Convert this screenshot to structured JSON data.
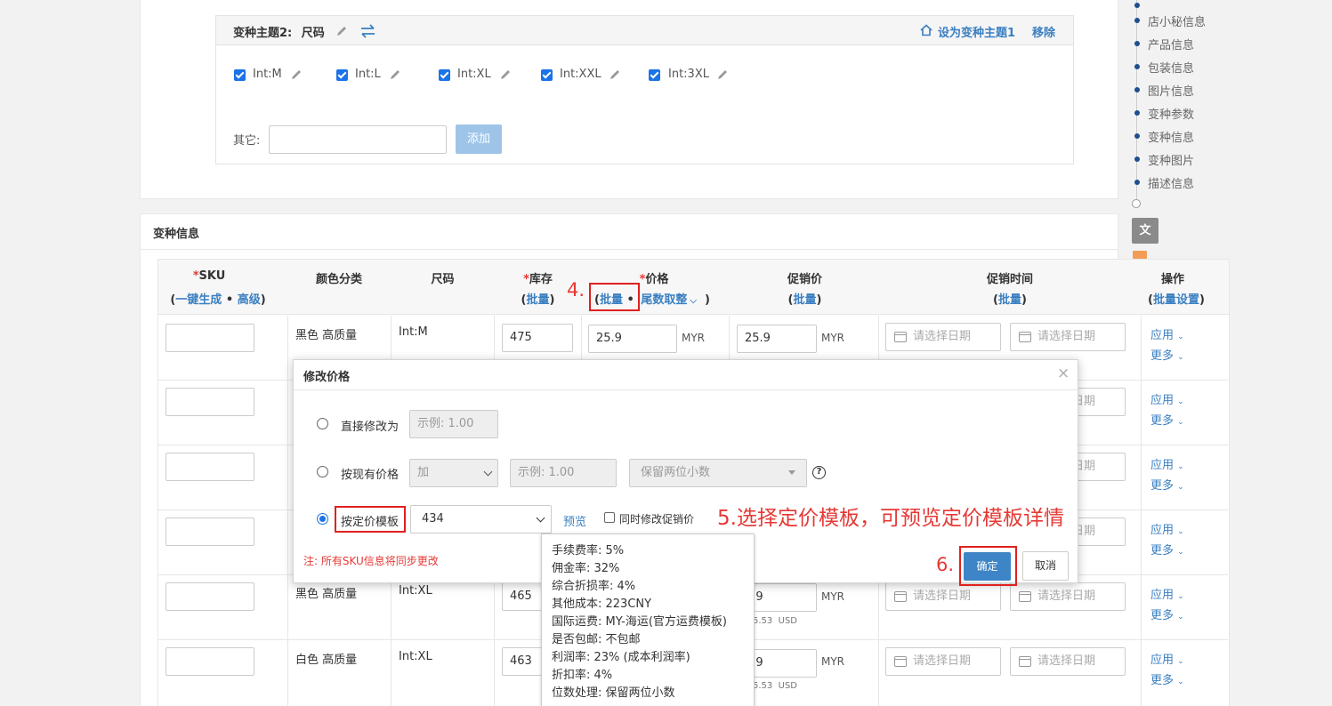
{
  "variant_theme": {
    "title": "变种主题2:",
    "name": "尺码",
    "set_primary": "设为变种主题1",
    "remove": "移除",
    "options": [
      "Int:M",
      "Int:L",
      "Int:XL",
      "Int:XXL",
      "Int:3XL"
    ],
    "other_label": "其它:",
    "add_button": "添加"
  },
  "variant_info": {
    "title": "变种信息",
    "headers": {
      "sku": "SKU",
      "sku_gen": "一键生成",
      "sku_adv": "高级",
      "color": "颜色分类",
      "size": "尺码",
      "stock": "库存",
      "stock_batch": "批量",
      "price": "价格",
      "price_batch": "批量",
      "price_round": "尾数取整",
      "promo_price": "促销价",
      "promo_batch": "批量",
      "promo_time": "促销时间",
      "promo_time_batch": "批量",
      "ops": "操作",
      "ops_batch": "批量设置"
    },
    "rows": [
      {
        "color": "黑色 高质量",
        "size": "Int:M",
        "stock": "475",
        "price": "25.9",
        "promo": "25.9"
      },
      {
        "color": "",
        "size": "",
        "stock": "",
        "price": "",
        "promo": ""
      },
      {
        "color": "",
        "size": "",
        "stock": "",
        "price": "",
        "promo": ""
      },
      {
        "color": "",
        "size": "",
        "stock": "",
        "price": "",
        "promo": ""
      },
      {
        "color": "黑色 高质量",
        "size": "Int:XL",
        "stock": "465",
        "price": "",
        "promo": "5.9"
      },
      {
        "color": "白色 高质量",
        "size": "Int:XL",
        "stock": "463",
        "price": "",
        "promo": "5.9"
      }
    ],
    "currency": "MYR",
    "usd_sub": "5.53  USD",
    "date_placeholder": "请选择日期",
    "apply": "应用",
    "more": "更多"
  },
  "dialog": {
    "title": "修改价格",
    "opt_direct": "直接修改为",
    "opt_direct_placeholder": "示例: 1.00",
    "opt_existing": "按现有价格",
    "opt_existing_op": "加",
    "opt_existing_placeholder": "示例: 1.00",
    "opt_existing_decimal": "保留两位小数",
    "opt_template": "按定价模板",
    "template_value": "434",
    "preview": "预览",
    "sync_promo": "同时修改促销价",
    "note": "注: 所有SKU信息将同步更改",
    "ok": "确定",
    "cancel": "取消"
  },
  "tooltip": [
    "手续费率: 5%",
    "佣金率: 32%",
    "综合折损率: 4%",
    "其他成本: 223CNY",
    "国际运费: MY-海运(官方运费模板)",
    "是否包邮: 不包邮",
    "利润率: 23% (成本利润率)",
    "折扣率: 4%",
    "位数处理: 保留两位小数"
  ],
  "annotations": {
    "step4": "4.",
    "step5": "5.选择定价模板，可预览定价模板详情",
    "step6": "6."
  },
  "side_nav": [
    "店小秘信息",
    "产品信息",
    "包装信息",
    "图片信息",
    "变种参数",
    "变种信息",
    "变种图片",
    "描述信息"
  ],
  "colors": {
    "accent": "#3a7fc1",
    "primary_button": "#3d85c6",
    "annotation": "#e02020"
  }
}
